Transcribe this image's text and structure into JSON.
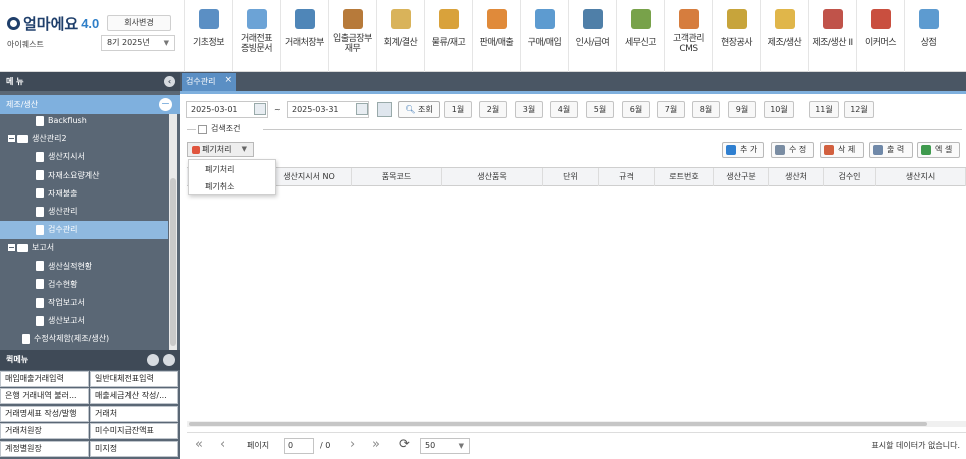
{
  "header": {
    "logo_text": "얼마에요",
    "version": "4.0",
    "company_change": "회사변경",
    "company_name": "아이퀘스트",
    "fiscal_year": "8기 2025년"
  },
  "topmenu": [
    {
      "label": "기초정보",
      "color": "#5b8fc4"
    },
    {
      "label": "거래전표\n증빙문서",
      "color": "#6ca3d6"
    },
    {
      "label": "거래처장부",
      "color": "#4f86b8"
    },
    {
      "label": "입출금장부\n재무",
      "color": "#b77a3a"
    },
    {
      "label": "회계/결산",
      "color": "#d9b35a"
    },
    {
      "label": "물류/재고",
      "color": "#d9a23b"
    },
    {
      "label": "판매/매출",
      "color": "#e08a3a"
    },
    {
      "label": "구매/매입",
      "color": "#5d9bd0"
    },
    {
      "label": "인사/급여",
      "color": "#4f7fa8"
    },
    {
      "label": "세무신고",
      "color": "#78a24a"
    },
    {
      "label": "고객관리\nCMS",
      "color": "#d67d3e"
    },
    {
      "label": "현장공사",
      "color": "#c7a43b"
    },
    {
      "label": "제조/생산",
      "color": "#e0b64a"
    },
    {
      "label": "제조/생산 II",
      "color": "#c0534a"
    },
    {
      "label": "이커머스",
      "color": "#c94f3f"
    },
    {
      "label": "상점",
      "color": "#5d9bd0"
    }
  ],
  "sidebar": {
    "title": "메 뉴",
    "category": "제조/생산",
    "tree": [
      {
        "label": "Backflush",
        "type": "file",
        "indent": 36
      },
      {
        "label": "생산관리2",
        "type": "folder",
        "indent": 8
      },
      {
        "label": "생산지시서",
        "type": "file",
        "indent": 36
      },
      {
        "label": "자재소요량계산",
        "type": "file",
        "indent": 36
      },
      {
        "label": "자재불출",
        "type": "file",
        "indent": 36
      },
      {
        "label": "생산관리",
        "type": "file",
        "indent": 36
      },
      {
        "label": "검수관리",
        "type": "file",
        "indent": 36,
        "selected": true
      },
      {
        "label": "보고서",
        "type": "folder",
        "indent": 8
      },
      {
        "label": "생산실적현황",
        "type": "file",
        "indent": 36
      },
      {
        "label": "검수현황",
        "type": "file",
        "indent": 36
      },
      {
        "label": "작업보고서",
        "type": "file",
        "indent": 36
      },
      {
        "label": "생산보고서",
        "type": "file",
        "indent": 36
      },
      {
        "label": "수정삭제함(제조/생산)",
        "type": "file",
        "indent": 22
      }
    ],
    "quick_title": "퀵메뉴",
    "quick": [
      [
        "매입매출거래입력",
        "일반대체전표입력"
      ],
      [
        "은행 거래내역 불러...",
        "매출세금계산 작성/..."
      ],
      [
        "거래명세표 작성/발행",
        "거래처"
      ],
      [
        "거래처원장",
        "미수미지급잔액표"
      ],
      [
        "계정별원장",
        "미지정"
      ]
    ]
  },
  "tab": {
    "label": "검수관리",
    "close": "×"
  },
  "filter": {
    "date_from": "2025-03-01",
    "date_to": "2025-03-31",
    "tilde": "~",
    "search": "조회",
    "months": [
      "1월",
      "2월",
      "3월",
      "4월",
      "5월",
      "6월",
      "7월",
      "8월",
      "9월",
      "10월",
      "11월",
      "12월"
    ],
    "cond_label": "검색조건"
  },
  "actions": {
    "dispose": "폐기처리",
    "add": "추 가",
    "edit": "수 정",
    "delete": "삭 제",
    "print": "출 력",
    "excel": "엑 셀"
  },
  "dropdown": {
    "items": [
      "폐기처리",
      "폐기취소"
    ]
  },
  "grid": {
    "columns": [
      "",
      "",
      "생산지시서 NO",
      "품목코드",
      "생산품목",
      "단위",
      "규격",
      "로트번호",
      "생산구분",
      "생산처",
      "검수인",
      "생산지시"
    ]
  },
  "pager": {
    "page_label": "페이지",
    "page": "0",
    "total": "/ 0",
    "page_size": "50",
    "status": "표시할 데이터가 없습니다."
  }
}
